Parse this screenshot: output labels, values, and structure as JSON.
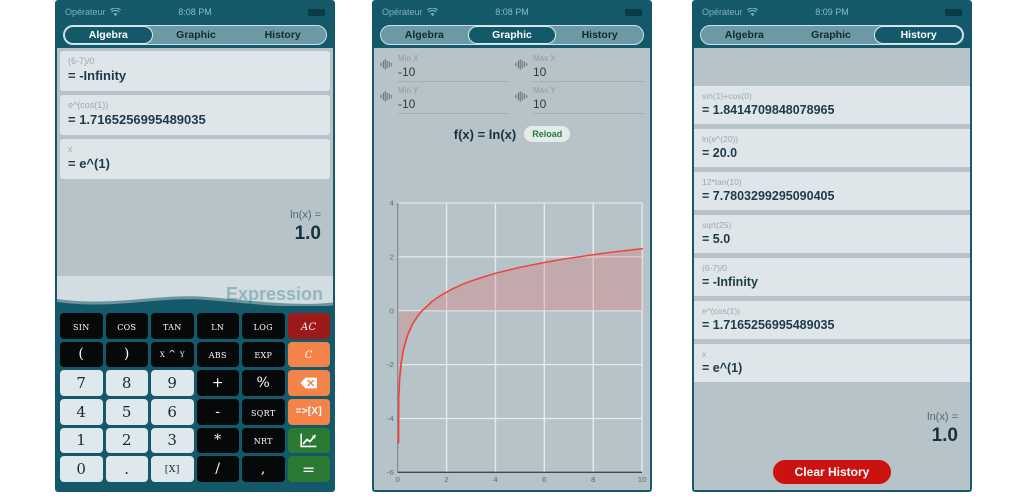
{
  "statusbar": {
    "carrier": "Opérateur",
    "wifi_icon": "wifi-icon",
    "time_algebra": "8:08 PM",
    "time_graphic": "8:08 PM",
    "time_history": "8:09 PM",
    "battery_icon": "battery-icon"
  },
  "tabs": {
    "algebra": "Algebra",
    "graphic": "Graphic",
    "history": "History"
  },
  "algebra": {
    "cards": [
      {
        "expression": "(6-7)/0",
        "result": "= -Infinity"
      },
      {
        "expression": "e^(cos(1))",
        "result": "= 1.7165256995489035"
      },
      {
        "expression": "x",
        "result": "= e^(1)"
      }
    ],
    "result_label": "ln(x) =",
    "result_value": "1.0",
    "input_placeholder": "Expression",
    "keys": [
      {
        "label": "SIN",
        "style": "fn",
        "name": "key-sin"
      },
      {
        "label": "COS",
        "style": "fn",
        "name": "key-cos"
      },
      {
        "label": "TAN",
        "style": "fn",
        "name": "key-tan"
      },
      {
        "label": "LN",
        "style": "fn",
        "name": "key-ln"
      },
      {
        "label": "LOG",
        "style": "fn",
        "name": "key-log"
      },
      {
        "label": "AC",
        "style": "ac",
        "name": "key-all-clear"
      },
      {
        "label": "(",
        "style": "op",
        "name": "key-open-paren"
      },
      {
        "label": ")",
        "style": "op",
        "name": "key-close-paren"
      },
      {
        "label": "x ^ y",
        "style": "varx",
        "name": "key-power"
      },
      {
        "label": "ABS",
        "style": "fn",
        "name": "key-abs"
      },
      {
        "label": "EXP",
        "style": "fn",
        "name": "key-exp"
      },
      {
        "label": "C",
        "style": "clr",
        "name": "key-clear"
      },
      {
        "label": "7",
        "style": "num",
        "name": "key-7"
      },
      {
        "label": "8",
        "style": "num",
        "name": "key-8"
      },
      {
        "label": "9",
        "style": "num",
        "name": "key-9"
      },
      {
        "label": "+",
        "style": "op",
        "name": "key-plus"
      },
      {
        "label": "%",
        "style": "op",
        "name": "key-percent"
      },
      {
        "label": "",
        "style": "del",
        "name": "key-backspace"
      },
      {
        "label": "4",
        "style": "num",
        "name": "key-4"
      },
      {
        "label": "5",
        "style": "num",
        "name": "key-5"
      },
      {
        "label": "6",
        "style": "num",
        "name": "key-6"
      },
      {
        "label": "-",
        "style": "op",
        "name": "key-minus"
      },
      {
        "label": "SQRT",
        "style": "fn",
        "name": "key-sqrt"
      },
      {
        "label": "=>[X]",
        "style": "tox",
        "name": "key-assign-x"
      },
      {
        "label": "1",
        "style": "num",
        "name": "key-1"
      },
      {
        "label": "2",
        "style": "num",
        "name": "key-2"
      },
      {
        "label": "3",
        "style": "num",
        "name": "key-3"
      },
      {
        "label": "*",
        "style": "op",
        "name": "key-multiply"
      },
      {
        "label": "NRT",
        "style": "fn",
        "name": "key-nth-root"
      },
      {
        "label": "",
        "style": "graph",
        "name": "key-graph"
      },
      {
        "label": "0",
        "style": "num",
        "name": "key-0"
      },
      {
        "label": ".",
        "style": "num",
        "name": "key-decimal"
      },
      {
        "label": "[X]",
        "style": "num varx",
        "name": "key-variable-x"
      },
      {
        "label": "/",
        "style": "op",
        "name": "key-divide"
      },
      {
        "label": ",",
        "style": "op",
        "name": "key-comma"
      },
      {
        "label": "=",
        "style": "eq",
        "name": "key-equals"
      }
    ]
  },
  "graphic": {
    "ranges": [
      {
        "label": "Min X",
        "value": "-10",
        "name": "min-x"
      },
      {
        "label": "Max X",
        "value": "10",
        "name": "max-x"
      },
      {
        "label": "Min Y",
        "value": "-10",
        "name": "min-y"
      },
      {
        "label": "Max Y",
        "value": "10",
        "name": "max-y"
      }
    ],
    "function_label": "f(x) = ln(x)",
    "reload_label": "Reload"
  },
  "history": {
    "items": [
      {
        "expression": "sin(1)+cos(0)",
        "result": "= 1.8414709848078965"
      },
      {
        "expression": "ln(e^(20))",
        "result": "= 20.0"
      },
      {
        "expression": "12*tan(10)",
        "result": "= 7.7803299295090405"
      },
      {
        "expression": "sqrt(25)",
        "result": "= 5.0"
      },
      {
        "expression": "(6-7)/0",
        "result": "= -Infinity"
      },
      {
        "expression": "e^(cos(1))",
        "result": "= 1.7165256995489035"
      },
      {
        "expression": "x",
        "result": "= e^(1)"
      }
    ],
    "result_label": "ln(x) =",
    "result_value": "1.0",
    "clear_label": "Clear History"
  },
  "colors": {
    "chrome": "#14596a",
    "panel": "#b6c3c8",
    "card": "#dfe6e9",
    "curve": "#f0413c",
    "accent_red": "#cc1111",
    "accent_green": "#2a7a33",
    "accent_orange": "#f4834a",
    "accent_darkred": "#9e1919"
  },
  "chart_data": {
    "type": "line",
    "title": "f(x) = ln(x)",
    "xlabel": "",
    "ylabel": "",
    "xlim": [
      0,
      10
    ],
    "ylim": [
      -6,
      4
    ],
    "xticks": [
      0,
      2,
      4,
      6,
      8,
      10
    ],
    "yticks": [
      -6,
      -4,
      -2,
      0,
      2,
      4
    ],
    "grid": true,
    "legend": false,
    "series": [
      {
        "name": "ln(x)",
        "color": "#f0413c",
        "fill": true,
        "x": [
          0.04,
          0.08,
          0.15,
          0.25,
          0.4,
          0.6,
          0.8,
          1.0,
          1.4,
          1.8,
          2.2,
          2.6,
          3.0,
          3.5,
          4.0,
          4.5,
          5.0,
          5.5,
          6.0,
          6.5,
          7.0,
          7.5,
          8.0,
          8.5,
          9.0,
          9.5,
          10.0
        ],
        "y": [
          -3.22,
          -2.53,
          -1.9,
          -1.39,
          -0.92,
          -0.51,
          -0.22,
          0.0,
          0.34,
          0.59,
          0.79,
          0.96,
          1.1,
          1.25,
          1.39,
          1.5,
          1.61,
          1.7,
          1.79,
          1.87,
          1.95,
          2.01,
          2.08,
          2.14,
          2.2,
          2.25,
          2.3
        ]
      }
    ]
  }
}
